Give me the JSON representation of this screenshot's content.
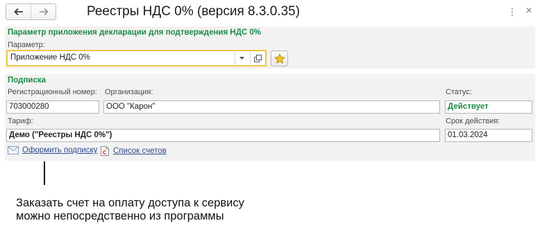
{
  "window": {
    "title": "Реестры НДС 0% (версия 8.3.0.35)",
    "back_icon": "arrow-left-icon",
    "forward_icon": "arrow-right-icon",
    "more_icon": "kebab-menu-icon",
    "more_glyph": "⋮",
    "close_icon": "close-icon",
    "close_glyph": "×"
  },
  "param_group": {
    "title": "Параметр приложения декларации для подтверждения НДС 0%",
    "param_label": "Параметр:",
    "param_value": "Приложение НДС 0%",
    "dropdown_icon": "chevron-down-icon",
    "open_icon": "open-form-icon",
    "favorite_icon": "star-icon"
  },
  "subscription": {
    "title": "Подписка",
    "reg_number_label": "Регистрационный номер:",
    "reg_number_value": "703000280",
    "organization_label": "Организация:",
    "organization_value": "ООО \"Карон\"",
    "status_label": "Статус:",
    "status_value": "Действует",
    "tariff_label": "Тариф:",
    "tariff_value": "Демо (\"Реестры НДС 0%\")",
    "valid_until_label": "Срок действия:",
    "valid_until_value": "01.03.2024",
    "subscribe_link": "Оформить подписку",
    "subscribe_icon": "envelope-icon",
    "invoices_link": "Список счетов",
    "invoices_icon": "invoice-document-icon"
  },
  "annotation": {
    "line1": "Заказать счет на оплату доступа к сервису",
    "line2": "можно непосредственно из программы"
  },
  "colors": {
    "group_title": "#1e8a4a",
    "link": "#2e4a8c",
    "focus_border": "#f1c542",
    "panel_bg": "#f2f2f2",
    "star": "#f2c21b"
  }
}
